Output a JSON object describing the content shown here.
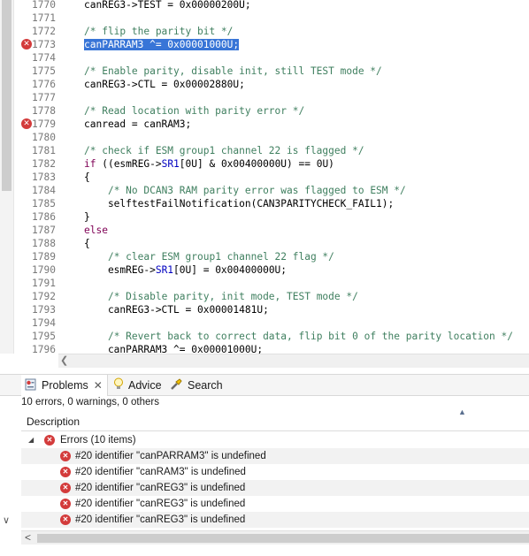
{
  "editor": {
    "lines": [
      {
        "num": "1770",
        "error": false,
        "segments": [
          {
            "t": "canREG3->TEST = 0x00000200U;",
            "c": ""
          }
        ]
      },
      {
        "num": "1771",
        "error": false,
        "segments": []
      },
      {
        "num": "1772",
        "error": false,
        "segments": [
          {
            "t": "/* flip the parity bit */",
            "c": "cm"
          }
        ]
      },
      {
        "num": "1773",
        "error": true,
        "segments": [
          {
            "t": "canPARRAM3 ^= 0x00001000U;",
            "c": "hl"
          }
        ]
      },
      {
        "num": "1774",
        "error": false,
        "segments": []
      },
      {
        "num": "1775",
        "error": false,
        "segments": [
          {
            "t": "/* Enable parity, disable init, still TEST mode */",
            "c": "cm"
          }
        ]
      },
      {
        "num": "1776",
        "error": false,
        "segments": [
          {
            "t": "canREG3->CTL = 0x00002880U;",
            "c": ""
          }
        ]
      },
      {
        "num": "1777",
        "error": false,
        "segments": []
      },
      {
        "num": "1778",
        "error": false,
        "segments": [
          {
            "t": "/* Read location with parity error */",
            "c": "cm"
          }
        ]
      },
      {
        "num": "1779",
        "error": true,
        "segments": [
          {
            "t": "canread = canRAM3;",
            "c": ""
          }
        ]
      },
      {
        "num": "1780",
        "error": false,
        "segments": []
      },
      {
        "num": "1781",
        "error": false,
        "segments": [
          {
            "t": "/* check if ESM group1 channel 22 is flagged */",
            "c": "cm"
          }
        ]
      },
      {
        "num": "1782",
        "error": false,
        "segments": [
          {
            "t": "if",
            "c": "kw"
          },
          {
            "t": " ((esmREG->",
            "c": ""
          },
          {
            "t": "SR1",
            "c": "fld"
          },
          {
            "t": "[0U] & 0x00400000U) == 0U)",
            "c": ""
          }
        ]
      },
      {
        "num": "1783",
        "error": false,
        "segments": [
          {
            "t": "{",
            "c": ""
          }
        ]
      },
      {
        "num": "1784",
        "error": false,
        "segments": [
          {
            "t": "    ",
            "c": ""
          },
          {
            "t": "/* No DCAN3 RAM parity error was flagged to ESM */",
            "c": "cm"
          }
        ]
      },
      {
        "num": "1785",
        "error": false,
        "segments": [
          {
            "t": "    selftestFailNotification(CAN3PARITYCHECK_FAIL1);",
            "c": ""
          }
        ]
      },
      {
        "num": "1786",
        "error": false,
        "segments": [
          {
            "t": "}",
            "c": ""
          }
        ]
      },
      {
        "num": "1787",
        "error": false,
        "segments": [
          {
            "t": "else",
            "c": "kw"
          }
        ]
      },
      {
        "num": "1788",
        "error": false,
        "segments": [
          {
            "t": "{",
            "c": ""
          }
        ]
      },
      {
        "num": "1789",
        "error": false,
        "segments": [
          {
            "t": "    ",
            "c": ""
          },
          {
            "t": "/* clear ESM group1 channel 22 flag */",
            "c": "cm"
          }
        ]
      },
      {
        "num": "1790",
        "error": false,
        "segments": [
          {
            "t": "    esmREG->",
            "c": ""
          },
          {
            "t": "SR1",
            "c": "fld"
          },
          {
            "t": "[0U] = 0x00400000U;",
            "c": ""
          }
        ]
      },
      {
        "num": "1791",
        "error": false,
        "segments": []
      },
      {
        "num": "1792",
        "error": false,
        "segments": [
          {
            "t": "    ",
            "c": ""
          },
          {
            "t": "/* Disable parity, init mode, TEST mode */",
            "c": "cm"
          }
        ]
      },
      {
        "num": "1793",
        "error": false,
        "segments": [
          {
            "t": "    canREG3->CTL = 0x00001481U;",
            "c": ""
          }
        ]
      },
      {
        "num": "1794",
        "error": false,
        "segments": []
      },
      {
        "num": "1795",
        "error": false,
        "segments": [
          {
            "t": "    ",
            "c": ""
          },
          {
            "t": "/* Revert back to correct data, flip bit 0 of the parity location */",
            "c": "cm"
          }
        ]
      },
      {
        "num": "1796",
        "error": false,
        "segments": [
          {
            "t": "    canPARRAM3 ^= 0x00001000U;",
            "c": ""
          }
        ]
      }
    ]
  },
  "tabs": [
    {
      "label": "Problems",
      "icon": "problems-icon"
    },
    {
      "label": "Advice",
      "icon": "lightbulb-icon"
    },
    {
      "label": "Search",
      "icon": "flashlight-search-icon"
    }
  ],
  "problems": {
    "summary": "10 errors, 0 warnings, 0 others",
    "column_header": "Description",
    "group_label": "Errors (10 items)",
    "items": [
      "#20 identifier \"canPARRAM3\" is undefined",
      "#20 identifier \"canRAM3\" is undefined",
      "#20 identifier \"canREG3\" is undefined",
      "#20 identifier \"canREG3\" is undefined",
      "#20 identifier \"canREG3\" is undefined"
    ]
  },
  "colors": {
    "error_red": "#d33b3b",
    "selection_blue": "#3875d7",
    "comment_green": "#3f7f5f",
    "keyword_purple": "#7f0055",
    "field_blue": "#0000c0"
  }
}
